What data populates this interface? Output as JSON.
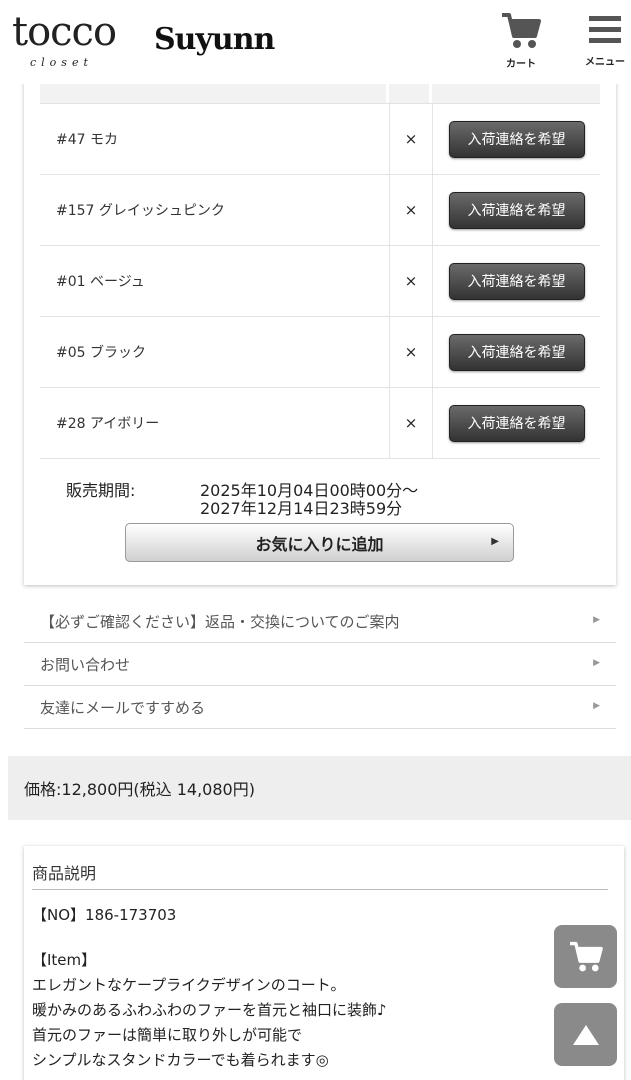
{
  "header": {
    "logo_main": "tocco",
    "logo_sub": "closet",
    "brand": "Suyunn",
    "cart_label": "カート",
    "menu_label": "メニュー"
  },
  "stock": {
    "rows": [
      {
        "name": "#47 モカ",
        "mark": "×",
        "button": "入荷連絡を希望"
      },
      {
        "name": "#157 グレイッシュピンク",
        "mark": "×",
        "button": "入荷連絡を希望"
      },
      {
        "name": "#01 ベージュ",
        "mark": "×",
        "button": "入荷連絡を希望"
      },
      {
        "name": "#05 ブラック",
        "mark": "×",
        "button": "入荷連絡を希望"
      },
      {
        "name": "#28 アイボリー",
        "mark": "×",
        "button": "入荷連絡を希望"
      }
    ]
  },
  "sales_period": {
    "label": "販売期間:",
    "start": "2025年10月04日00時00分〜",
    "end": "2027年12月14日23時59分"
  },
  "favorite_button": "お気に入りに追加",
  "links": [
    "【必ずご確認ください】返品・交換についてのご案内",
    "お問い合わせ",
    "友達にメールですすめる"
  ],
  "price": "価格:12,800円(税込 14,080円)",
  "description": {
    "title": "商品説明",
    "number": "【NO】186-173703",
    "item_heading": "【Item】",
    "lines": [
      "エレガントなケープライクデザインのコート。",
      "暖かみのあるふわふわのファーを首元と袖口に装飾♪",
      "首元のファーは簡単に取り外しが可能で",
      "シンプルなスタンドカラーでも着られます◎"
    ]
  },
  "colors": {
    "button_dark": "#444444",
    "float_button": "#8a8a8a",
    "price_bg": "#eeeeee"
  },
  "icons": {
    "cart": "cart-icon",
    "menu": "hamburger-menu-icon",
    "scroll_top": "arrow-up-icon"
  }
}
